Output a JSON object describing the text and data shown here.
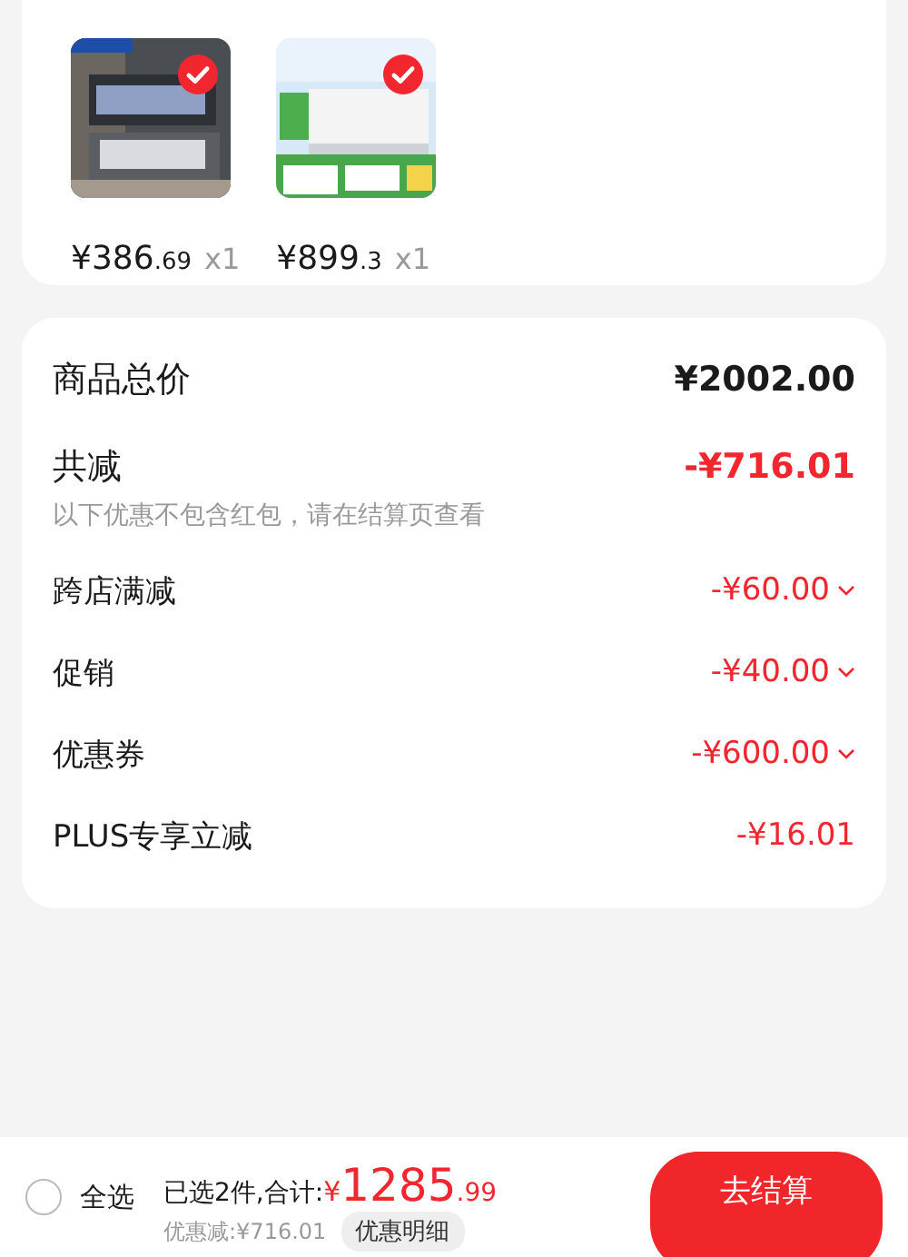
{
  "products": [
    {
      "kind": "picture",
      "checked": true,
      "price_main": "¥386",
      "price_decimal": ".69",
      "quantity": "x1"
    },
    {
      "kind": "picture",
      "checked": true,
      "price_main": "¥899",
      "price_decimal": ".3",
      "quantity": "x1"
    }
  ],
  "summary": {
    "total_label": "商品总价",
    "total_value": "¥2002.00",
    "reduce_label": "共减",
    "reduce_value": "-¥716.01",
    "note": "以下优惠不包含红包，请在结算页查看",
    "discounts": [
      {
        "label": "跨店满减",
        "value": "-¥60.00",
        "expandable": true
      },
      {
        "label": "促销",
        "value": "-¥40.00",
        "expandable": true
      },
      {
        "label": "优惠券",
        "value": "-¥600.00",
        "expandable": true
      },
      {
        "label": "PLUS专享立减",
        "value": "-¥16.01",
        "expandable": false
      }
    ]
  },
  "footer": {
    "select_all": {
      "label": "全选",
      "checked": false
    },
    "selected_text": "已选2件,合计:",
    "currency": "¥",
    "total_main": "1285",
    "total_decimal": ".99",
    "saved": "优惠减:¥716.01",
    "details_button": "优惠明细",
    "checkout_button": "去结算"
  }
}
